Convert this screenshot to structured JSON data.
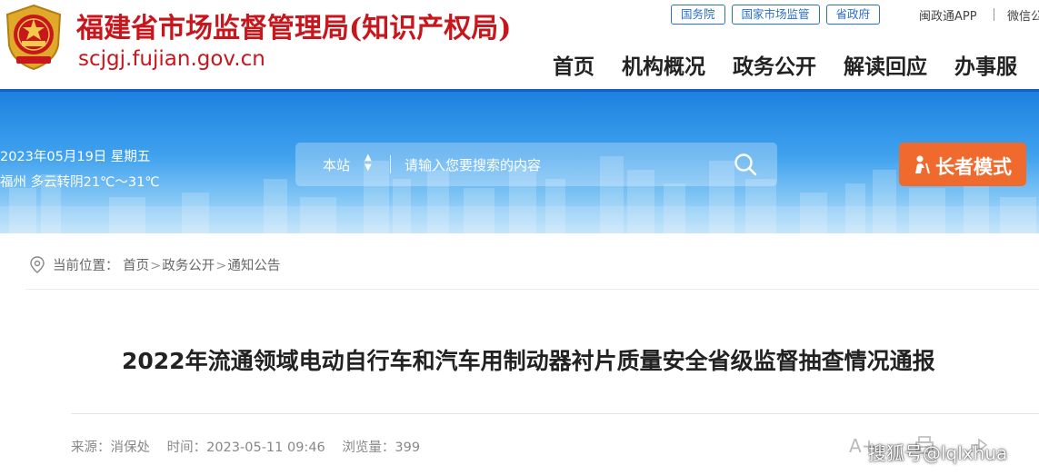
{
  "header": {
    "site_name": "福建省市场监督管理局(知识产权局)",
    "domain": "scjgj.fujian.gov.cn",
    "top_links": [
      "国务院",
      "国家市场监管",
      "省政府"
    ],
    "app_link": "闽政通APP",
    "wechat_link": "微信公",
    "nav": [
      "首页",
      "机构概况",
      "政务公开",
      "解读回应",
      "办事服"
    ]
  },
  "banner": {
    "date": "2023年05月19日  星期五",
    "weather": "福州  多云转阴21℃～31℃",
    "search": {
      "scope": "本站",
      "placeholder": "请输入您要搜索的内容"
    },
    "elder_mode": "长者模式"
  },
  "breadcrumb": {
    "prefix": "当前位置：",
    "items": [
      "首页",
      "政务公开",
      "通知公告"
    ],
    "separator": ">"
  },
  "article": {
    "title": "2022年流通领域电动自行车和汽车用制动器衬片质量安全省级监督抽查情况通报",
    "source": "来源：消保处",
    "time": "时间：2023-05-11 09:46",
    "views": "浏览量：399"
  },
  "tools": {
    "font_size": "A+"
  },
  "watermark": "搜狐号@lqlxhua",
  "colors": {
    "brand_red": "#c8161d",
    "link_blue": "#2a6fc9",
    "banner_blue": "#1d82df",
    "elder_orange": "#f06a2e"
  }
}
